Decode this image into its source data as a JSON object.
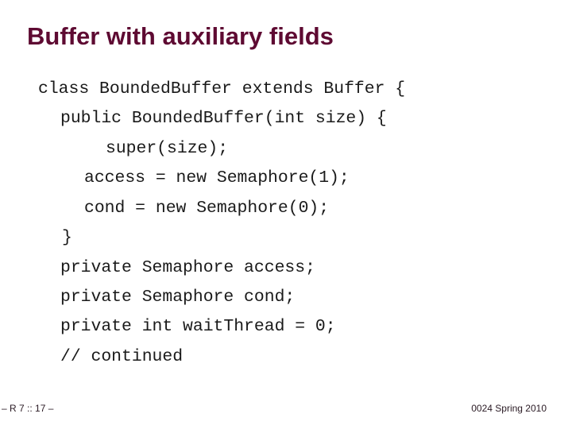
{
  "slide": {
    "title": "Buffer with auxiliary fields",
    "code_lines": [
      "class BoundedBuffer extends Buffer {",
      "public BoundedBuffer(int size) {",
      "super(size);",
      "access = new Semaphore(1);",
      "cond = new Semaphore(0);",
      "}",
      "private Semaphore access;",
      "private Semaphore cond;",
      "private int waitThread = 0;",
      "// continued"
    ]
  },
  "footer": {
    "left": "– R 7 ::  17 –",
    "right": "0024 Spring 2010"
  },
  "colors": {
    "title": "#5e0a32",
    "code": "#1a1a1a"
  }
}
